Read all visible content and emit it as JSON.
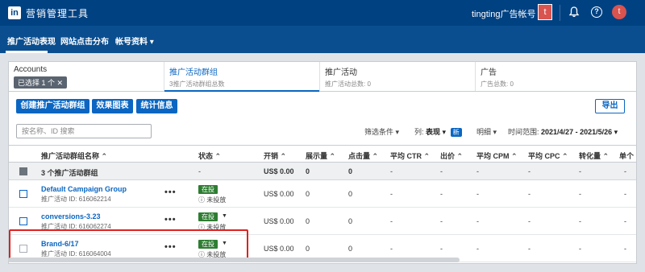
{
  "app": {
    "logo": "in",
    "title": "营销管理工具",
    "account_name": "tingting广告帐号",
    "account_avatar": "t",
    "user_avatar": "t",
    "help_glyph": "?"
  },
  "nav": {
    "items": [
      {
        "label": "推广活动表现"
      },
      {
        "label": "网站点击分布"
      },
      {
        "label": "帐号资料 ▾"
      }
    ]
  },
  "tabs": {
    "accounts": {
      "title": "Accounts",
      "chip": "已选择 1 个 ✕"
    },
    "campaign_groups": {
      "title": "推广活动群组",
      "sub": "3推广活动群组总数"
    },
    "campaigns": {
      "title": "推广活动",
      "sub": "推广活动总数: 0"
    },
    "ads": {
      "title": "广告",
      "sub": "广告总数: 0"
    }
  },
  "toolbar": {
    "create_label": "创建推广活动群组",
    "effect_label": "效果图表",
    "stats_label": "统计信息",
    "export_label": "导出"
  },
  "search": {
    "placeholder": "按名称、ID 搜索"
  },
  "filters": {
    "filter_label": "筛选条件 ▾",
    "columns_label": "列:",
    "columns_value": "表现 ▾",
    "new_badge": "新",
    "detail_label": "明细 ▾",
    "range_label": "时间范围:",
    "range_value": "2021/4/27 - 2021/5/26 ▾"
  },
  "table": {
    "headers": [
      "推广活动群组名称 ⌃",
      "状态 ⌃",
      "开销 ⌃",
      "展示量 ⌃",
      "点击量 ⌃",
      "平均 CTR ⌃",
      "出价 ⌃",
      "平均 CPM ⌃",
      "平均 CPC ⌃",
      "转化量 ⌃",
      "单个"
    ],
    "total": {
      "name": "3 个推广活动群组",
      "status": "-",
      "spend": "US$ 0.00",
      "impressions": "0",
      "clicks": "0",
      "ctr": "-",
      "bid": "-",
      "cpm": "-",
      "cpc": "-",
      "conversions": "-",
      "extra": "-"
    },
    "rows": [
      {
        "name": "Default Campaign Group",
        "id": "推广活动 ID: 616062214",
        "dots": "•••",
        "status": "在投",
        "status_sub": "ⓘ 未投放",
        "spend": "US$ 0.00",
        "impressions": "0",
        "clicks": "0",
        "ctr": "-",
        "bid": "-",
        "cpm": "-",
        "cpc": "-",
        "conversions": "-",
        "extra": "-"
      },
      {
        "name": "conversions-3.23",
        "id": "推广活动 ID: 616062274",
        "dots": "•••",
        "status": "在投",
        "status_sub": "ⓘ 未投放",
        "spend": "US$ 0.00",
        "impressions": "0",
        "clicks": "0",
        "ctr": "-",
        "bid": "-",
        "cpm": "-",
        "cpc": "-",
        "conversions": "-",
        "extra": "-"
      },
      {
        "name": "Brand-6/17",
        "id": "推广活动 ID: 616064004",
        "dots": "•••",
        "status": "在投",
        "status_sub": "ⓘ 未投放",
        "spend": "US$ 0.00",
        "impressions": "0",
        "clicks": "0",
        "ctr": "-",
        "bid": "-",
        "cpm": "-",
        "cpc": "-",
        "conversions": "-",
        "extra": "-"
      }
    ]
  }
}
